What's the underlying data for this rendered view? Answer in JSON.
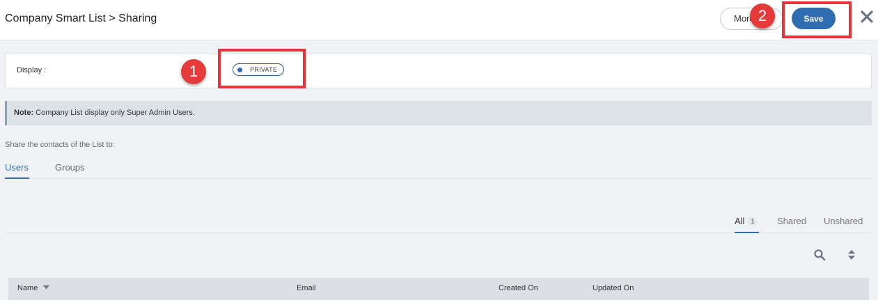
{
  "header": {
    "title": "Company Smart List > Sharing",
    "more_label": "More",
    "save_label": "Save",
    "close_icon": "close-icon"
  },
  "callouts": [
    "1",
    "2"
  ],
  "display": {
    "label": "Display :",
    "toggle_label": "PRIVATE"
  },
  "note": {
    "prefix": "Note:",
    "text": " Company List display only Super Admin Users."
  },
  "share_heading": "Share the contacts of the List to:",
  "tabs": [
    {
      "label": "Users",
      "active": true
    },
    {
      "label": "Groups",
      "active": false
    }
  ],
  "filters": [
    {
      "label": "All",
      "count": "1",
      "active": true
    },
    {
      "label": "Shared",
      "active": false
    },
    {
      "label": "Unshared",
      "active": false
    }
  ],
  "table": {
    "columns": [
      "Name",
      "Email",
      "Created On",
      "Updated On"
    ]
  },
  "colors": {
    "accent": "#2f6cb0",
    "callout": "#e63b3b"
  }
}
